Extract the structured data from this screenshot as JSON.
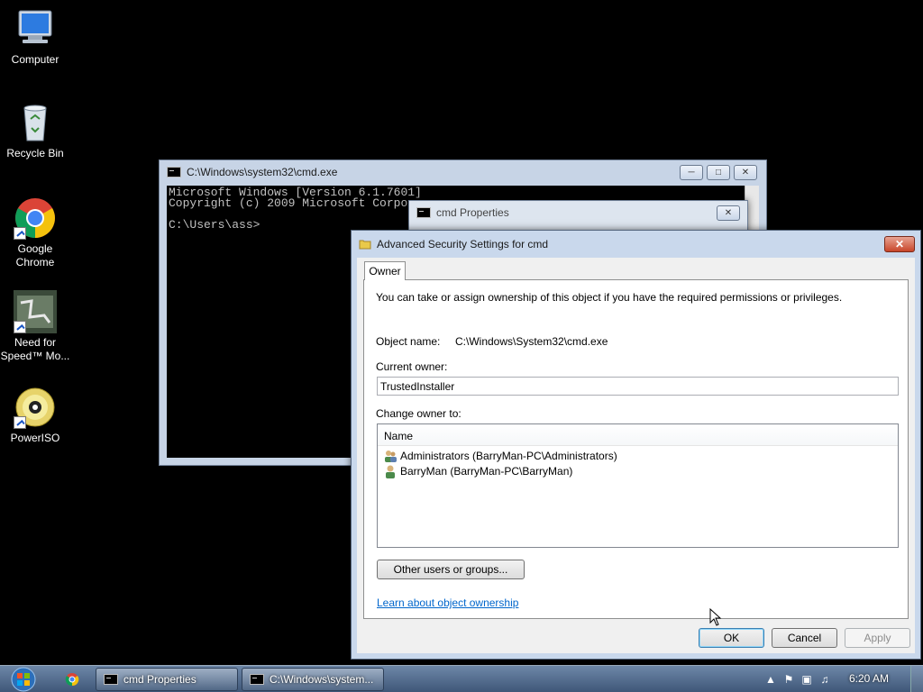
{
  "desktop": {
    "icons": [
      {
        "label": "Computer"
      },
      {
        "label": "Recycle Bin"
      },
      {
        "label": "Google Chrome"
      },
      {
        "label": "Need for Speed™ Mo..."
      },
      {
        "label": "PowerISO"
      }
    ]
  },
  "cmd_window": {
    "title": "C:\\Windows\\system32\\cmd.exe",
    "console_lines": [
      "Microsoft Windows [Version 6.1.7601]",
      "Copyright (c) 2009 Microsoft Corpo",
      "",
      "C:\\Users\\ass>"
    ]
  },
  "props_window": {
    "title": "cmd Properties"
  },
  "adv_dialog": {
    "title": "Advanced Security Settings for cmd",
    "tab_label": "Owner",
    "intro": "You can take or assign ownership of this object if you have the required permissions or privileges.",
    "object_name_label": "Object name:",
    "object_name_value": "C:\\Windows\\System32\\cmd.exe",
    "current_owner_label": "Current owner:",
    "current_owner_value": "TrustedInstaller",
    "change_owner_label": "Change owner to:",
    "list_header": "Name",
    "owners": [
      {
        "name": "Administrators (BarryMan-PC\\Administrators)",
        "icon": "group-icon"
      },
      {
        "name": "BarryMan (BarryMan-PC\\BarryMan)",
        "icon": "user-icon"
      }
    ],
    "other_users_button": "Other users or groups...",
    "learn_link": "Learn about object ownership",
    "ok_button": "OK",
    "cancel_button": "Cancel",
    "apply_button": "Apply"
  },
  "taskbar": {
    "tasks": [
      {
        "label": "cmd Properties"
      },
      {
        "label": "C:\\Windows\\system..."
      }
    ],
    "clock": "6:20 AM"
  }
}
